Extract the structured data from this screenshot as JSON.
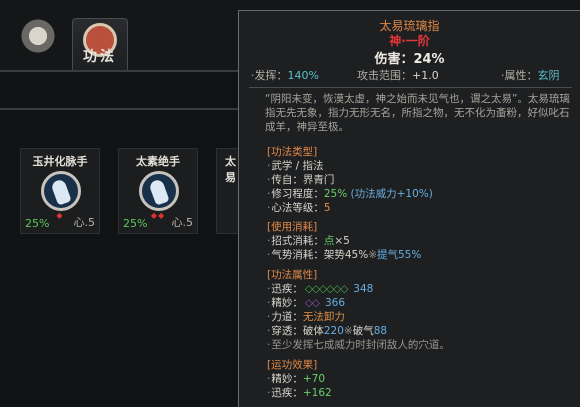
{
  "tabs": [
    {
      "name": "mask",
      "label": ""
    },
    {
      "name": "gongfa",
      "label": "功法"
    }
  ],
  "skills": [
    {
      "name": "玉井化脉手",
      "pct": "25%",
      "lvl": "心.5",
      "gems": "◆"
    },
    {
      "name": "太素绝手",
      "pct": "25%",
      "lvl": "心.5",
      "gems": "◆◆"
    },
    {
      "name": "太易",
      "pct": "",
      "lvl": "",
      "gems": ""
    }
  ],
  "tooltip": {
    "title": "太易琉璃指",
    "grade": "神·一阶",
    "damage": "伤害：24%",
    "attr_fahui_label": "·发挥：",
    "attr_fahui_value": "140%",
    "attr_range_label": "攻击范围：",
    "attr_range_value": "+1.0",
    "attr_prop_label": "·属性：",
    "attr_prop_value": "玄阴",
    "description": "“阴阳未变，恢漠太虚，神之始而未见气也，谓之太易”。太易琉璃指无先无象，指力无形无名，所指之物，无不化为齑粉，好似叱石成羊，神异至极。",
    "sections": {
      "type": {
        "title": "[功法类型]",
        "category": "武学 / 指法",
        "school_label": "传自：",
        "school_value": "界青门",
        "mastery_label": "修习程度：",
        "mastery_value": "25%",
        "mastery_note": "(功法威力+10%)",
        "heart_label": "心法等级：",
        "heart_value": "5"
      },
      "cost": {
        "title": "[使用消耗]",
        "move_label": "招式消耗：",
        "move_value": "点",
        "move_count": "×5",
        "qi_label": "气势消耗：",
        "qi_value1": "架势45%",
        "qi_sep": "※",
        "qi_value2": "提气55%"
      },
      "attrs": {
        "title": "[功法属性]",
        "speed_label": "迅疾：",
        "speed_value": "348",
        "finesse_label": "精妙：",
        "finesse_value": "366",
        "force_label": "力道：",
        "force_value": "无法卸力",
        "pierce_label": "穿透：",
        "pierce_a": "破体",
        "pierce_a_val": "220",
        "pierce_sep": "※",
        "pierce_b": "破气",
        "pierce_b_val": "88",
        "note": "至少发挥七成威力时封闭敌人的穴道。"
      },
      "effect": {
        "title": "[运功效果]",
        "finesse_label": "精妙：",
        "finesse_value": "+70",
        "speed_label": "迅疾：",
        "speed_value": "+162"
      }
    }
  }
}
